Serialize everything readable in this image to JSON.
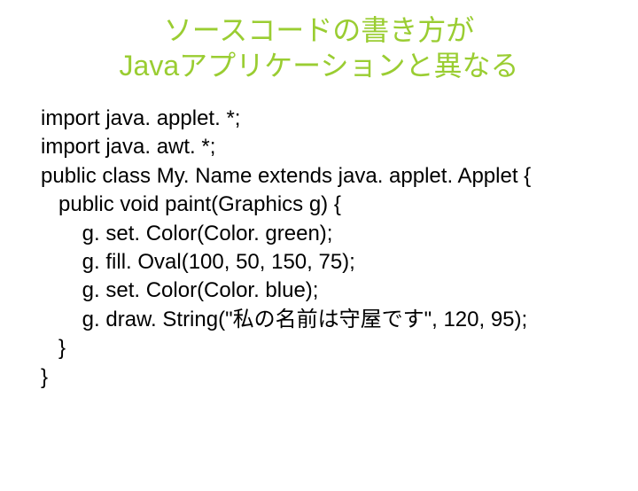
{
  "title": {
    "line1": "ソースコードの書き方が",
    "line2": "Javaアプリケーションと異なる"
  },
  "code": {
    "l1": "import java. applet. *;",
    "l2": "import java. awt. *;",
    "l3": "public class My. Name extends java. applet. Applet {",
    "l4": "   public void paint(Graphics g) {",
    "l5": "       g. set. Color(Color. green);",
    "l6": "       g. fill. Oval(100, 50, 150, 75);",
    "l7": "       g. set. Color(Color. blue);",
    "l8": "       g. draw. String(\"私の名前は守屋です\", 120, 95);",
    "l9": "   }",
    "l10": "}"
  }
}
